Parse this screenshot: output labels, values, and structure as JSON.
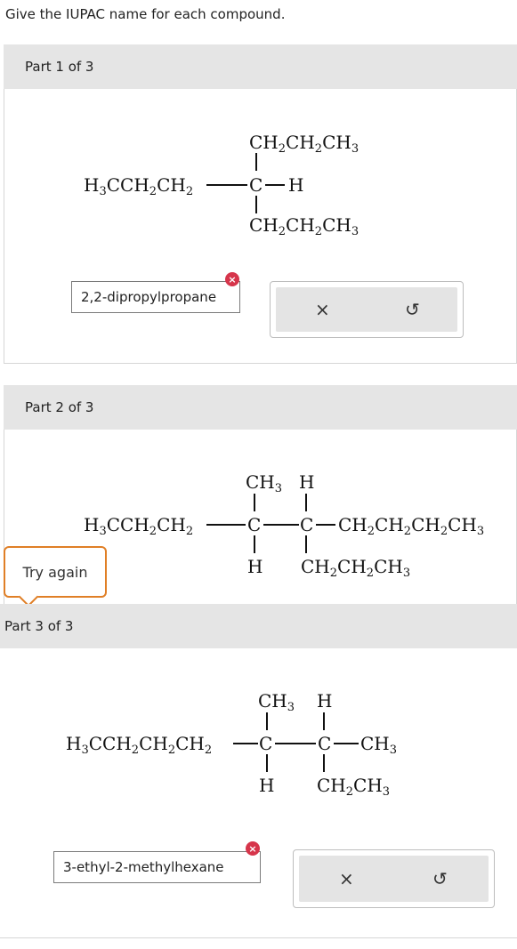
{
  "prompt": "Give the IUPAC name for each compound.",
  "parts": [
    {
      "header": "Part 1 of 3",
      "molecule": {
        "top": [
          "CH",
          "2",
          "CH",
          "2",
          "CH",
          "3"
        ],
        "left": [
          "H",
          "3",
          "CCH",
          "2",
          "CH",
          "2"
        ],
        "center": "C",
        "right": "H",
        "bottom": [
          "CH",
          "2",
          "CH",
          "2",
          "CH",
          "3"
        ]
      },
      "answer": "2,2-dipropylpropane",
      "status": "incorrect"
    },
    {
      "header": "Part 2 of 3",
      "molecule": {
        "left": [
          "H",
          "3",
          "CCH",
          "2",
          "CH",
          "2"
        ],
        "c1_top": [
          "CH",
          "3"
        ],
        "c1": "C",
        "c1_bottom": "H",
        "c2_top": "H",
        "c2": "C",
        "right": [
          "CH",
          "2",
          "CH",
          "2",
          "CH",
          "2",
          "CH",
          "3"
        ],
        "c2_bottom": [
          "CH",
          "2",
          "CH",
          "2",
          "CH",
          "3"
        ]
      }
    },
    {
      "header": "Part 3 of 3",
      "molecule": {
        "left": [
          "H",
          "3",
          "CCH",
          "2",
          "CH",
          "2",
          "CH",
          "2"
        ],
        "c1_top": [
          "CH",
          "3"
        ],
        "c1": "C",
        "c1_bottom": "H",
        "c2_top": "H",
        "c2": "C",
        "right": [
          "CH",
          "3"
        ],
        "c2_bottom": [
          "CH",
          "2",
          "CH",
          "3"
        ]
      },
      "answer": "3-ethyl-2-methylhexane",
      "status": "incorrect"
    }
  ],
  "toolbox": {
    "clear_icon": "×",
    "undo_icon": "↺"
  },
  "try_again": "Try again",
  "badge_icon": "×"
}
